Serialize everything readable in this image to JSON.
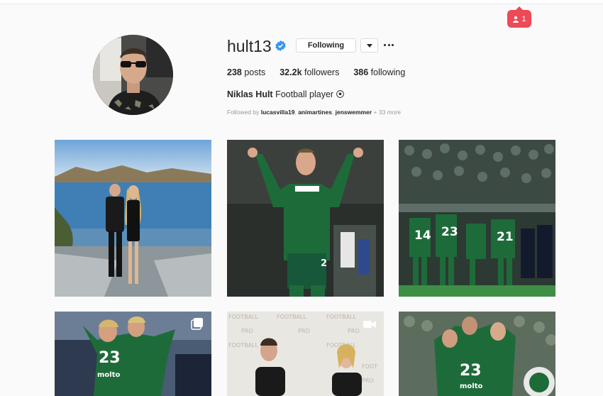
{
  "notification": {
    "count": "1",
    "icon": "person-icon",
    "color": "#ed4956"
  },
  "profile": {
    "username": "hult13",
    "verified": true,
    "follow_button": "Following",
    "stats": {
      "posts": "238",
      "posts_label": "posts",
      "followers": "32.2k",
      "followers_label": "followers",
      "following": "386",
      "following_label": "following"
    },
    "full_name": "Niklas Hult",
    "bio": "Football player",
    "followed_by_prefix": "Followed by",
    "followed_by_users": [
      "lucasvilla19",
      "animartines",
      "jenswemmer"
    ],
    "followed_by_more": "+ 33 more"
  },
  "posts": [
    {
      "name": "post-beach-couple",
      "type": "image"
    },
    {
      "name": "post-celebrating-player",
      "type": "image"
    },
    {
      "name": "post-team-crowd",
      "type": "image"
    },
    {
      "name": "post-team-hug",
      "type": "carousel",
      "icon": "carousel-icon"
    },
    {
      "name": "post-football-pro-interview",
      "type": "video",
      "icon": "video-icon"
    },
    {
      "name": "post-team-celebration",
      "type": "image"
    }
  ],
  "colors": {
    "accent": "#3897f0",
    "green_kit": "#1e6b3a"
  }
}
